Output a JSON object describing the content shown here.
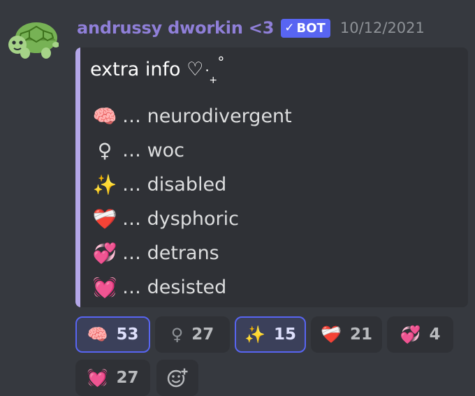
{
  "message": {
    "username": "andrussy dworkin <3",
    "bot_tag": "BOT",
    "bot_check": "✓",
    "timestamp": "10/12/2021"
  },
  "embed": {
    "title": "extra info",
    "title_heart": "♡",
    "title_dot": "·",
    "title_plus": "+",
    "title_degree": "°",
    "accent_color": "#b4a7e8",
    "lines": [
      {
        "emoji": "🧠",
        "icon": "brain-icon",
        "text": "… neurodivergent"
      },
      {
        "emoji": "♀",
        "icon": "female-sign-icon",
        "text": "… woc"
      },
      {
        "emoji": "✨",
        "icon": "sparkles-icon",
        "text": "… disabled"
      },
      {
        "emoji": "❤️‍🩹",
        "icon": "mending-heart-icon",
        "text": "… dysphoric"
      },
      {
        "emoji": "💞",
        "icon": "revolving-hearts-icon",
        "text": "… detrans"
      },
      {
        "emoji": "💓",
        "icon": "beating-heart-icon",
        "text": "… desisted"
      }
    ]
  },
  "reactions": [
    {
      "emoji": "🧠",
      "icon": "brain-icon",
      "count": "53",
      "me": true
    },
    {
      "emoji": "♀",
      "icon": "female-sign-icon",
      "count": "27",
      "me": false
    },
    {
      "emoji": "✨",
      "icon": "sparkles-icon",
      "count": "15",
      "me": true
    },
    {
      "emoji": "❤️‍🩹",
      "icon": "mending-heart-icon",
      "count": "21",
      "me": false
    },
    {
      "emoji": "💞",
      "icon": "revolving-hearts-icon",
      "count": "4",
      "me": false
    },
    {
      "emoji": "💓",
      "icon": "beating-heart-icon",
      "count": "27",
      "me": false
    }
  ],
  "colors": {
    "background": "#36393f",
    "username": "#8f7fd8",
    "bot_tag": "#5865f2",
    "reaction_active_border": "#5865f2"
  }
}
